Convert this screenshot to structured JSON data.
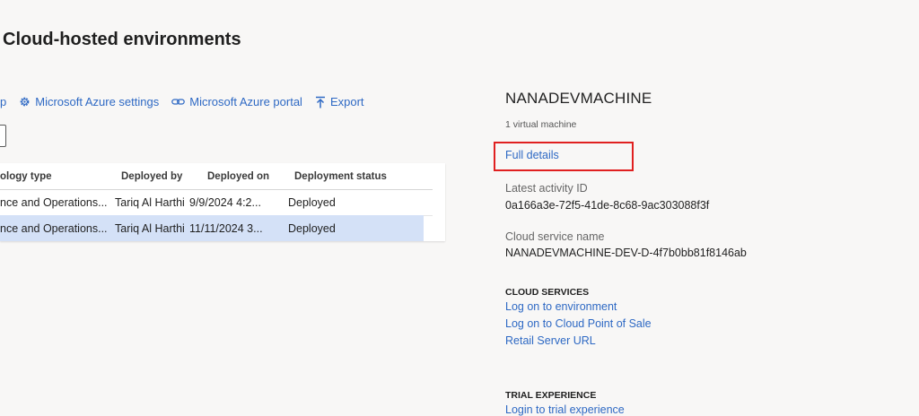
{
  "page": {
    "title": "Cloud-hosted environments"
  },
  "toolbar": {
    "items": [
      {
        "label": "p",
        "icon": "none"
      },
      {
        "label": "Microsoft Azure settings",
        "icon": "gear-icon"
      },
      {
        "label": "Microsoft Azure portal",
        "icon": "link-icon"
      },
      {
        "label": "Export",
        "icon": "export-icon"
      }
    ]
  },
  "grid": {
    "headers": [
      "ology type",
      "Deployed by",
      "Deployed on",
      "Deployment status"
    ],
    "rows": [
      {
        "topology": "nce and Operations...",
        "deployed_by": "Tariq Al Harthi",
        "deployed_on": "9/9/2024 4:2...",
        "status": "Deployed",
        "selected": false
      },
      {
        "topology": "nce and Operations...",
        "deployed_by": "Tariq Al Harthi",
        "deployed_on": "11/11/2024 3...",
        "status": "Deployed",
        "selected": true
      }
    ]
  },
  "details": {
    "name": "NANADEVMACHINE",
    "vm_count": "1 virtual machine",
    "full_details": "Full details",
    "latest_activity_label": "Latest activity ID",
    "latest_activity_value": "0a166a3e-72f5-41de-8c68-9ac303088f3f",
    "cloud_service_label": "Cloud service name",
    "cloud_service_value": "NANADEVMACHINE-DEV-D-4f7b0bb81f8146ab",
    "cloud_services_heading": "CLOUD SERVICES",
    "cloud_links": [
      "Log on to environment",
      "Log on to Cloud Point of Sale",
      "Retail Server URL"
    ],
    "trial_heading": "TRIAL EXPERIENCE",
    "trial_links": [
      "Login to trial experience"
    ]
  },
  "colors": {
    "link": "#2e69c4",
    "selected_row": "#d4e1f7",
    "highlight_border": "#e02020",
    "background": "#f8f7f6"
  }
}
